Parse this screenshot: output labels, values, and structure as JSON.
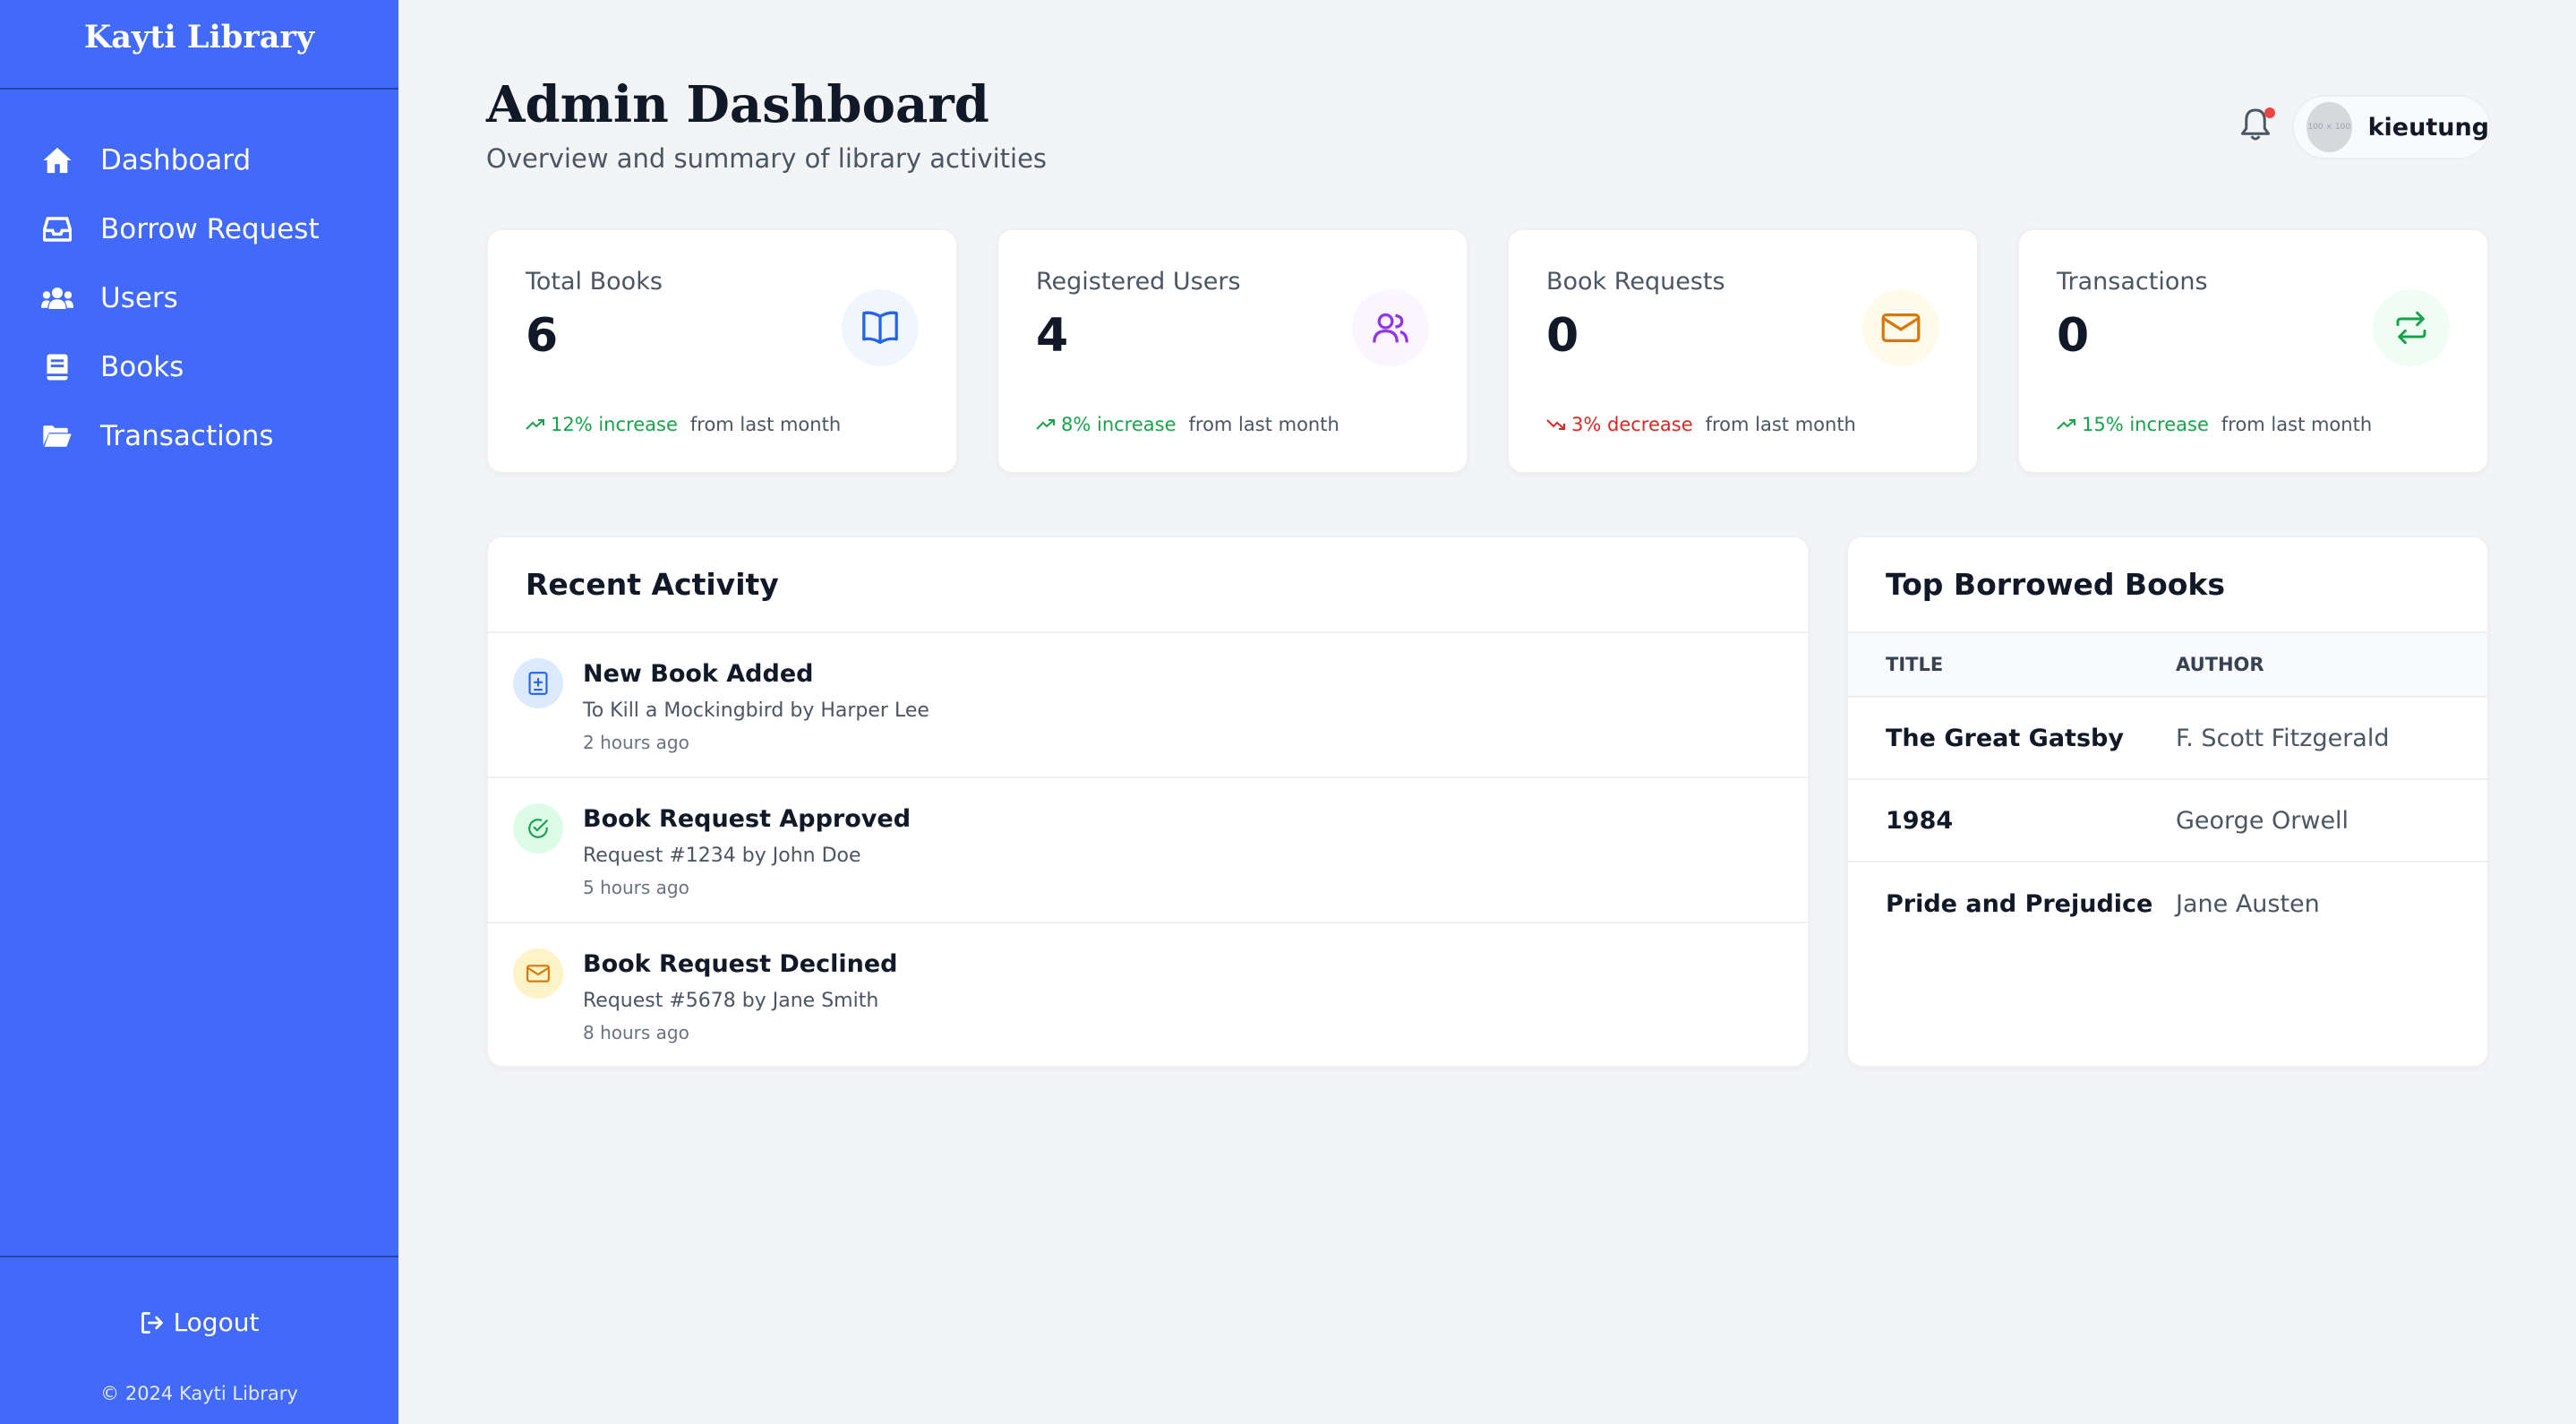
{
  "sidebar": {
    "brand": "Kayti Library",
    "items": [
      {
        "label": "Dashboard",
        "icon": "home-icon"
      },
      {
        "label": "Borrow Request",
        "icon": "inbox-icon"
      },
      {
        "label": "Users",
        "icon": "users-icon"
      },
      {
        "label": "Books",
        "icon": "book-icon"
      },
      {
        "label": "Transactions",
        "icon": "folder-open-icon"
      }
    ],
    "logout": "Logout",
    "copyright": "© 2024 Kayti Library"
  },
  "header": {
    "title": "Admin Dashboard",
    "subtitle": "Overview and summary of library activities",
    "username": "kieutung",
    "avatar_placeholder": "100 × 100"
  },
  "stats": [
    {
      "label": "Total Books",
      "value": "6",
      "trend": "12% increase",
      "suffix": "from last month",
      "direction": "up",
      "icon": "book-open-icon",
      "icon_color": "#2563eb",
      "icon_bg": "#eff6ff"
    },
    {
      "label": "Registered Users",
      "value": "4",
      "trend": "8% increase",
      "suffix": "from last month",
      "direction": "up",
      "icon": "users-icon",
      "icon_color": "#9333ea",
      "icon_bg": "#faf5ff"
    },
    {
      "label": "Book Requests",
      "value": "0",
      "trend": "3% decrease",
      "suffix": "from last month",
      "direction": "down",
      "icon": "mail-icon",
      "icon_color": "#d97706",
      "icon_bg": "#fffbeb"
    },
    {
      "label": "Transactions",
      "value": "0",
      "trend": "15% increase",
      "suffix": "from last month",
      "direction": "up",
      "icon": "repeat-icon",
      "icon_color": "#16a34a",
      "icon_bg": "#f0fdf4"
    }
  ],
  "recent_activity": {
    "title": "Recent Activity",
    "items": [
      {
        "title": "New Book Added",
        "desc": "To Kill a Mockingbird by Harper Lee",
        "time": "2 hours ago",
        "icon": "book-plus-icon",
        "icon_color": "#2563eb",
        "icon_bg": "#dbeafe"
      },
      {
        "title": "Book Request Approved",
        "desc": "Request #1234 by John Doe",
        "time": "5 hours ago",
        "icon": "check-circle-icon",
        "icon_color": "#16a34a",
        "icon_bg": "#dcfce7"
      },
      {
        "title": "Book Request Declined",
        "desc": "Request #5678 by Jane Smith",
        "time": "8 hours ago",
        "icon": "mail-icon",
        "icon_color": "#d97706",
        "icon_bg": "#fef3c7"
      }
    ]
  },
  "top_borrowed": {
    "title": "Top Borrowed Books",
    "columns": [
      "TITLE",
      "AUTHOR"
    ],
    "rows": [
      {
        "title": "The Great Gatsby",
        "author": "F. Scott Fitzgerald"
      },
      {
        "title": "1984",
        "author": "George Orwell"
      },
      {
        "title": "Pride and Prejudice",
        "author": "Jane Austen"
      }
    ]
  },
  "colors": {
    "sidebar": "#4169fa",
    "trend_up": "#16a34a",
    "trend_down": "#dc2626",
    "notification_dot": "#ef4444"
  }
}
